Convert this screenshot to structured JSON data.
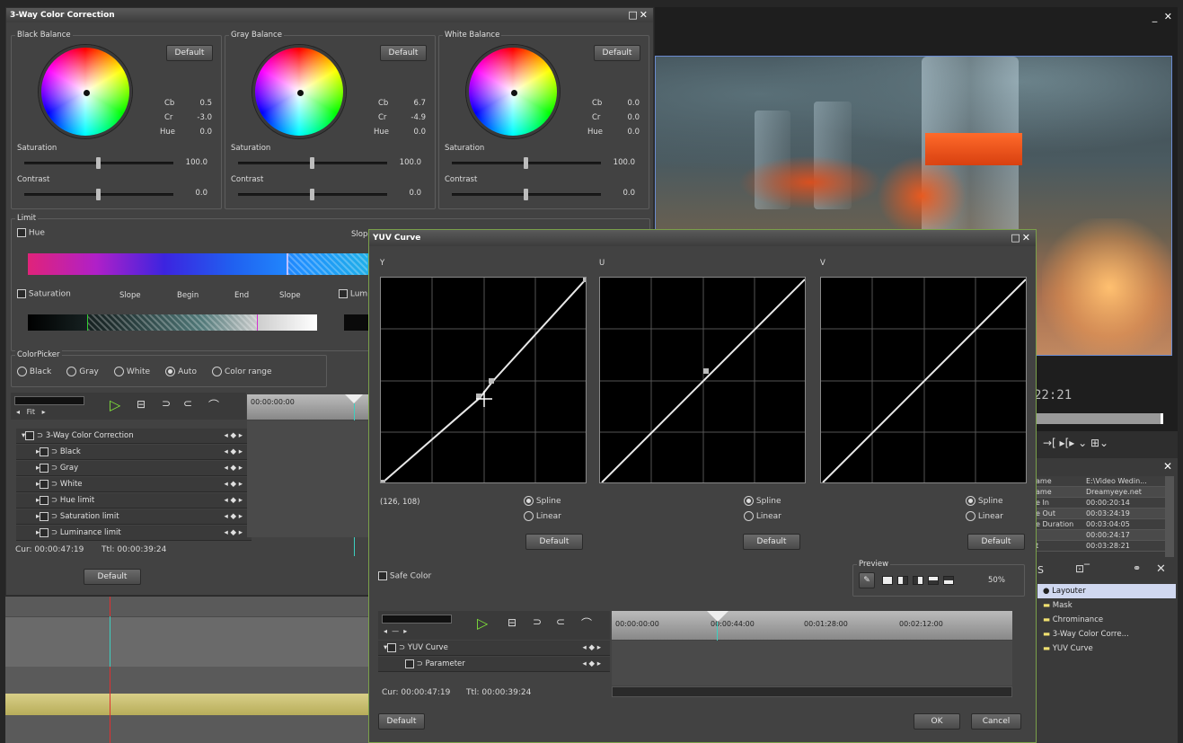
{
  "three_way": {
    "title": "3-Way Color Correction",
    "black": {
      "label": "Black Balance",
      "cb": "0.5",
      "cr": "-3.0",
      "hue": "0.0",
      "saturation": "100.0",
      "contrast": "0.0",
      "default": "Default",
      "sat_label": "Saturation",
      "con_label": "Contrast"
    },
    "gray": {
      "label": "Gray Balance",
      "cb": "6.7",
      "cr": "-4.9",
      "hue": "0.0",
      "saturation": "100.0",
      "contrast": "0.0",
      "default": "Default",
      "sat_label": "Saturation",
      "con_label": "Contrast"
    },
    "white": {
      "label": "White Balance",
      "cb": "0.0",
      "cr": "0.0",
      "hue": "0.0",
      "saturation": "100.0",
      "contrast": "0.0",
      "default": "Default",
      "sat_label": "Saturation",
      "con_label": "Contrast"
    },
    "cb": "Cb",
    "cr": "Cr",
    "hue": "Hue",
    "limit": {
      "label": "Limit",
      "hue": "Hue",
      "slope": "Slope",
      "saturation": "Saturation",
      "slope2": "Slope",
      "begin": "Begin",
      "end": "End",
      "slope3": "Slope",
      "lum": "Lum"
    },
    "picker": {
      "label": "ColorPicker",
      "options": [
        "Black",
        "Gray",
        "White",
        "Auto",
        "Color range"
      ],
      "selected": "Auto"
    },
    "timeline": {
      "fit": "Fit",
      "ruler": "00:00:00:00",
      "ruler2": "00:00",
      "rows": [
        "3-Way Color Correction",
        "Black",
        "Gray",
        "White",
        "Hue limit",
        "Saturation limit",
        "Luminance limit"
      ],
      "cur": "Cur: 00:00:47:19",
      "ttl": "Ttl: 00:00:39:24"
    },
    "default": "Default"
  },
  "preview": {
    "timecode": "22:21"
  },
  "props": {
    "rows": [
      [
        "ame",
        "E:\\Video Wedin..."
      ],
      [
        "ame",
        "Dreamyeye.net"
      ],
      [
        "e In",
        "00:00:20:14"
      ],
      [
        "e Out",
        "00:03:24:19"
      ],
      [
        "e Duration",
        "00:03:04:05"
      ],
      [
        "",
        "00:00:24:17"
      ],
      [
        "t",
        "00:03:28:21"
      ]
    ]
  },
  "effects": {
    "tab": "S",
    "items": [
      "Layouter",
      "Mask",
      "Chrominance",
      "3-Way Color Corre...",
      "YUV Curve"
    ]
  },
  "yuv": {
    "title": "YUV Curve",
    "y": "Y",
    "u": "U",
    "v": "V",
    "coord": "(126, 108)",
    "spline": "Spline",
    "linear": "Linear",
    "default": "Default",
    "safe_color": "Safe Color",
    "preview": {
      "label": "Preview",
      "percent": "50%"
    },
    "timeline": {
      "t0": "00:00:00:00",
      "t1": "00:00:44:00",
      "t2": "00:01:28:00",
      "t3": "00:02:12:00",
      "rows": [
        "YUV Curve",
        "Parameter"
      ],
      "cur": "Cur: 00:00:47:19",
      "ttl": "Ttl: 00:00:39:24"
    },
    "ok": "OK",
    "cancel": "Cancel"
  }
}
